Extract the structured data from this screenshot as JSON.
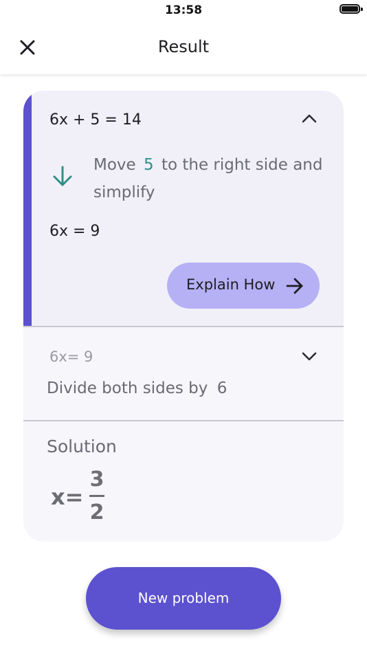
{
  "status_bar": {
    "time": "13:58"
  },
  "nav": {
    "title": "Result",
    "close_icon": "close-icon"
  },
  "steps": [
    {
      "equation": "6x + 5 = 14",
      "expanded": true,
      "description_prefix": "Move",
      "description_number": "5",
      "description_suffix": "to the right side and simplify",
      "result_equation": "6x = 9",
      "explain_label": "Explain How",
      "explain_icon": "arrow-right-icon",
      "step_icon": "arrow-down-icon"
    },
    {
      "equation": "6x= 9",
      "expanded": false,
      "description_prefix": "Divide both sides by",
      "description_number": "6"
    }
  ],
  "solution": {
    "label": "Solution",
    "variable": "x=",
    "numerator": "3",
    "denominator": "2"
  },
  "new_problem_label": "New problem",
  "colors": {
    "accent": "#5c51cf",
    "explain_button": "#b6b0f5",
    "highlight_number": "#2f8f86",
    "card_background": "#f7f6fb"
  }
}
